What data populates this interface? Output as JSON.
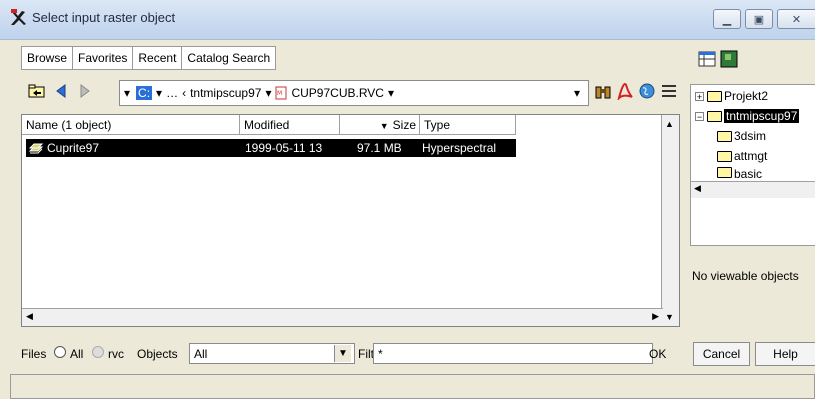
{
  "window": {
    "title": "Select input raster object"
  },
  "tabs": [
    {
      "label": "Browse"
    },
    {
      "label": "Favorites"
    },
    {
      "label": "Recent"
    },
    {
      "label": "Catalog Search"
    }
  ],
  "path": {
    "drive": "C:",
    "ellipsis": "…",
    "folder": "tntmipscup97",
    "file": "CUP97CUB.RVC",
    "dropdown_glyph": "▾"
  },
  "list": {
    "columns": [
      "Name  (1 object)",
      "Modified",
      "Size",
      "Type"
    ],
    "sort_indicator": "▼",
    "rows": [
      {
        "name": "Cuprite97",
        "modified": "1999-05-11 13",
        "size": "97.1 MB",
        "type": "Hyperspectral"
      }
    ]
  },
  "bottom": {
    "files_label": "Files",
    "all_label": "All",
    "rvc_label": "rvc",
    "objects_label": "Objects",
    "objects_value": "All",
    "filter_label": "Filter",
    "filter_value": "*",
    "ok_label": "OK",
    "cancel_label": "Cancel",
    "help_label": "Help"
  },
  "right_panel": {
    "tree": [
      {
        "label": "Projekt2",
        "expander": "⊞",
        "level": 0
      },
      {
        "label": "tntmipscup97",
        "expander": "⊟",
        "level": 0,
        "selected": true
      },
      {
        "label": "3dsim",
        "level": 1
      },
      {
        "label": "attmgt",
        "level": 1
      },
      {
        "label": "basic",
        "level": 1
      }
    ],
    "no_view_text": "No viewable objects"
  },
  "colors": {
    "selection": "#000000",
    "window_bg": "#ece9d8",
    "titlebar": "#c9daf0",
    "folder_yellow": "#fff6a6"
  }
}
